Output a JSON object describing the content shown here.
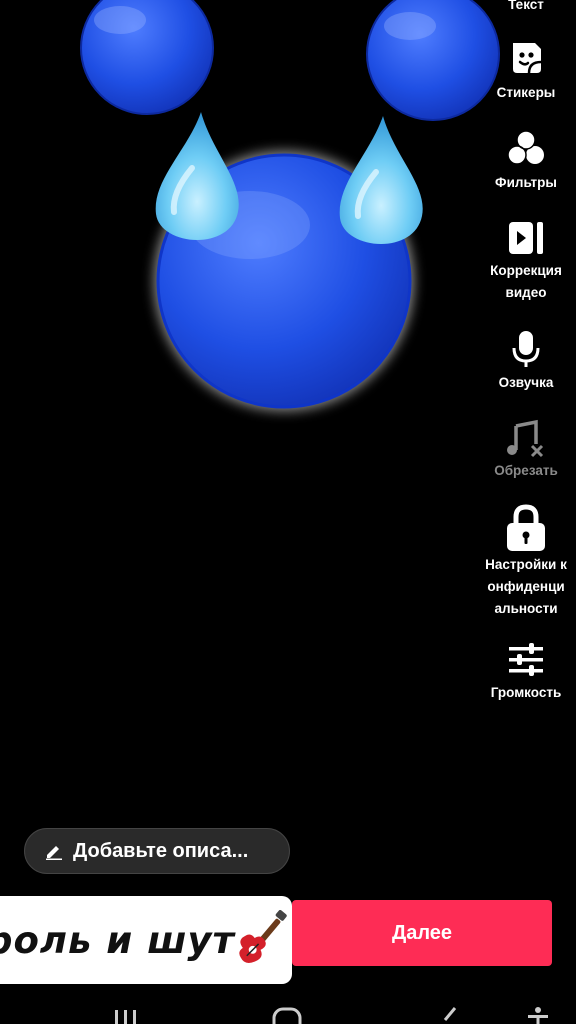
{
  "sidebar": {
    "items": [
      {
        "label": "Текст",
        "icon": "text-icon"
      },
      {
        "label": "Стикеры",
        "icon": "sticker-icon"
      },
      {
        "label": "Фильтры",
        "icon": "filters-icon"
      },
      {
        "label": "Коррекция видео",
        "icon": "video-correction-icon"
      },
      {
        "label": "Озвучка",
        "icon": "microphone-icon"
      },
      {
        "label": "Обрезать",
        "icon": "music-trim-icon",
        "disabled": true
      },
      {
        "label": "Настройки конфиденциальности",
        "icon": "lock-icon"
      },
      {
        "label": "Громкость",
        "icon": "volume-sliders-icon"
      }
    ]
  },
  "description": {
    "label": "Добавьте описа..."
  },
  "overlay_text": {
    "label": "роль и шут"
  },
  "next_button": {
    "label": "Далее"
  },
  "colors": {
    "accent": "#fe2c55",
    "ball": "#1e4fe0",
    "drop": "#5ec4f2"
  }
}
